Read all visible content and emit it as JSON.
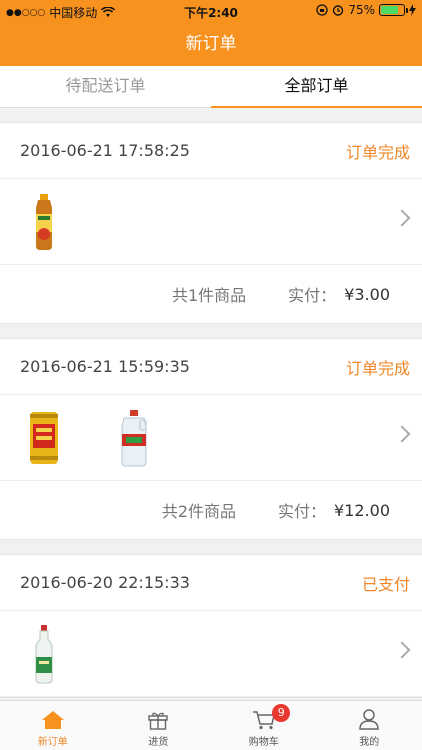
{
  "status_bar": {
    "signal": "●●○○○",
    "carrier": "中国移动",
    "time": "下午2:40",
    "battery": "75%",
    "battery_level": 0.75
  },
  "navbar": {
    "title": "新订单"
  },
  "tabs": [
    {
      "label": "待配送订单",
      "active": false
    },
    {
      "label": "全部订单",
      "active": true
    }
  ],
  "orders": [
    {
      "time": "2016-06-21 17:58:25",
      "status": "订单完成",
      "items": [
        "tea-bottle"
      ],
      "count_text": "共1件商品",
      "paid_label": "实付：",
      "paid_value": "¥3.00"
    },
    {
      "time": "2016-06-21 15:59:35",
      "status": "订单完成",
      "items": [
        "herbal-tea-can",
        "water-jug"
      ],
      "count_text": "共2件商品",
      "paid_label": "实付：",
      "paid_value": "¥12.00"
    },
    {
      "time": "2016-06-20 22:15:33",
      "status": "已支付",
      "items": [
        "liquor-bottle"
      ]
    }
  ],
  "tabbar": [
    {
      "label": "新订单",
      "icon": "home-icon",
      "active": true
    },
    {
      "label": "进货",
      "icon": "gift-icon",
      "active": false
    },
    {
      "label": "购物车",
      "icon": "cart-icon",
      "active": false,
      "badge": "9"
    },
    {
      "label": "我的",
      "icon": "user-icon",
      "active": false
    }
  ],
  "colors": {
    "accent": "#f8921f",
    "status": "#f0882a",
    "badge": "#e8382f"
  }
}
